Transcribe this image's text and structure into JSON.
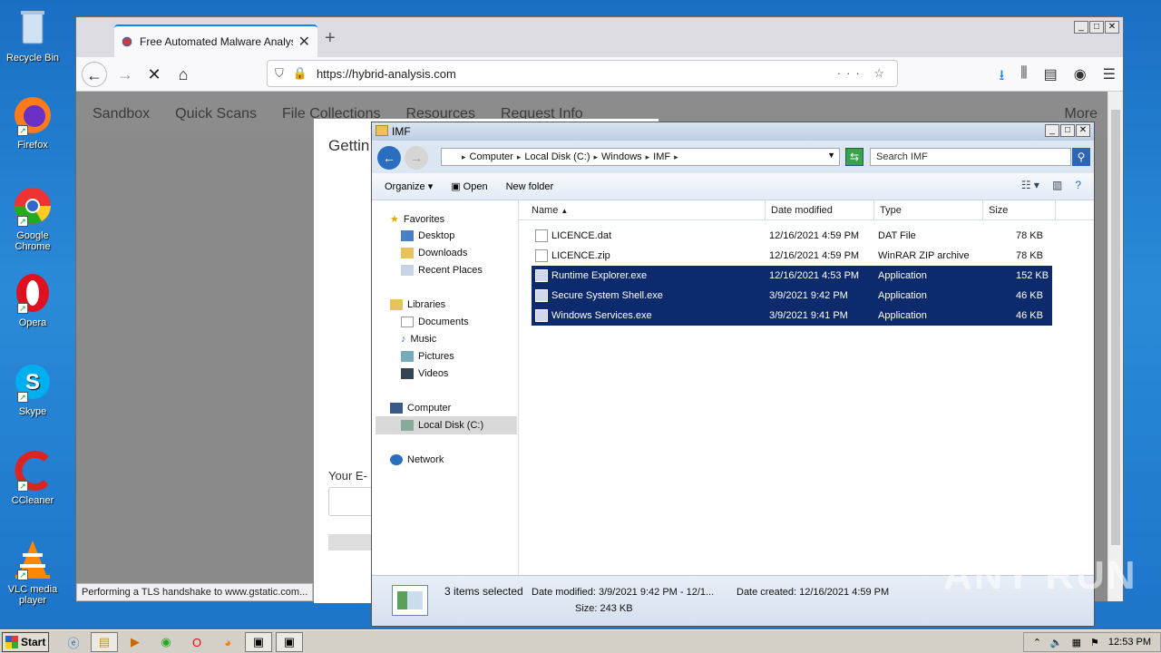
{
  "desktop": {
    "icons": [
      {
        "label": "Recycle Bin"
      },
      {
        "label": "Firefox"
      },
      {
        "label": "Google Chrome"
      },
      {
        "label": "Opera"
      },
      {
        "label": "Skype"
      },
      {
        "label": "CCleaner"
      },
      {
        "label": "VLC media player"
      }
    ]
  },
  "browser": {
    "tab_title": "Free Automated Malware Analysis",
    "url": "https://hybrid-analysis.com",
    "site_nav": [
      "Sandbox",
      "Quick Scans",
      "File Collections",
      "Resources",
      "Request Info"
    ],
    "site_nav_more": "More",
    "modal_title": "Gettin",
    "email_label": "Your E-",
    "status_message": "Performing a TLS handshake to www.gstatic.com..."
  },
  "explorer": {
    "title": "IMF",
    "breadcrumb": [
      "Computer",
      "Local Disk (C:)",
      "Windows",
      "IMF"
    ],
    "search_placeholder": "Search IMF",
    "toolbar": {
      "organize": "Organize",
      "open": "Open",
      "new_folder": "New folder"
    },
    "nav": {
      "favorites": "Favorites",
      "desktop": "Desktop",
      "downloads": "Downloads",
      "recent_places": "Recent Places",
      "libraries": "Libraries",
      "documents": "Documents",
      "music": "Music",
      "pictures": "Pictures",
      "videos": "Videos",
      "computer": "Computer",
      "local_disk": "Local Disk (C:)",
      "network": "Network"
    },
    "columns": {
      "name": "Name",
      "date": "Date modified",
      "type": "Type",
      "size": "Size"
    },
    "files": [
      {
        "name": "LICENCE.dat",
        "date": "12/16/2021 4:59 PM",
        "type": "DAT File",
        "size": "78 KB",
        "selected": false
      },
      {
        "name": "LICENCE.zip",
        "date": "12/16/2021 4:59 PM",
        "type": "WinRAR ZIP archive",
        "size": "78 KB",
        "selected": false
      },
      {
        "name": "Runtime Explorer.exe",
        "date": "12/16/2021 4:53 PM",
        "type": "Application",
        "size": "152 KB",
        "selected": true
      },
      {
        "name": "Secure System Shell.exe",
        "date": "3/9/2021 9:42 PM",
        "type": "Application",
        "size": "46 KB",
        "selected": true
      },
      {
        "name": "Windows Services.exe",
        "date": "3/9/2021 9:41 PM",
        "type": "Application",
        "size": "46 KB",
        "selected": true
      }
    ],
    "status": {
      "count": "3 items selected",
      "date_modified": "Date modified: 3/9/2021 9:42 PM - 12/1...",
      "date_created": "Date created: 12/16/2021 4:59 PM",
      "size": "Size: 243 KB"
    }
  },
  "taskbar": {
    "start_label": "Start",
    "clock": "12:53 PM"
  },
  "watermark": "ANY RUN"
}
